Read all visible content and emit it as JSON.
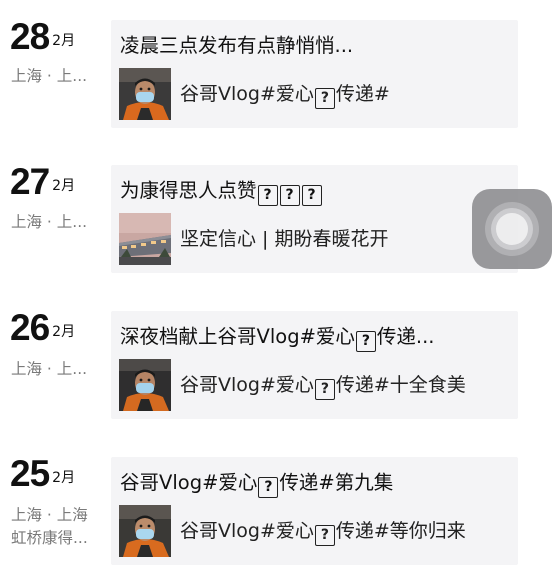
{
  "posts": [
    {
      "day": "28",
      "month": "2月",
      "location": [
        "上海 · 上..."
      ],
      "title": [
        "凌晨三点发布有点静悄悄..."
      ],
      "share": [
        "谷哥Vlog#爱心",
        "?",
        "传递#"
      ],
      "thumb": "selfie-masked-man"
    },
    {
      "day": "27",
      "month": "2月",
      "location": [
        "上海 · 上..."
      ],
      "title": [
        "为康得思人点赞",
        "?",
        "?",
        "?"
      ],
      "share": [
        "坚定信心 | 期盼春暖花开"
      ],
      "thumb": "hotel-building-dusk"
    },
    {
      "day": "26",
      "month": "2月",
      "location": [
        "上海 · 上..."
      ],
      "title": [
        "深夜档献上谷哥Vlog#爱心",
        "?",
        "传递..."
      ],
      "share": [
        "谷哥Vlog#爱心",
        "?",
        "传递#十全食美"
      ],
      "thumb": "selfie-masked-man"
    },
    {
      "day": "25",
      "month": "2月",
      "location": [
        "上海 · 上海",
        "虹桥康得..."
      ],
      "title": [
        "谷哥Vlog#爱心",
        "?",
        "传递#第九集"
      ],
      "share": [
        "谷哥Vlog#爱心",
        "?",
        "传递#等你归来"
      ],
      "thumb": "selfie-masked-man"
    }
  ],
  "colors": {
    "card_bg": "#f4f4f6",
    "location_text": "#7a7a7a",
    "main_text": "#111111",
    "assistive_touch": "#8f8f92"
  },
  "icons": {
    "missing_emoji": "missing-glyph-box-icon",
    "floating_button": "assistive-touch-icon"
  }
}
